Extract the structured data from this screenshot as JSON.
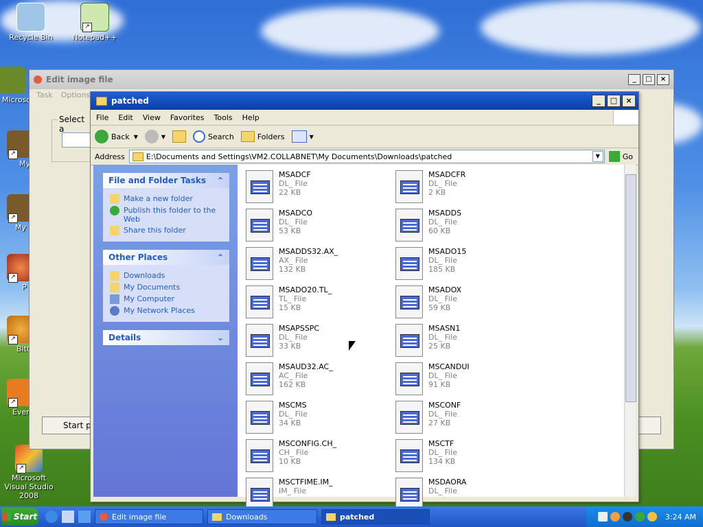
{
  "desktop": {
    "icons": [
      {
        "label": "Recycle Bin",
        "icon": "recycle-bin-icon"
      },
      {
        "label": "Notepad++",
        "icon": "notepad-icon"
      },
      {
        "label": "Microsoft Visual Studio 2008",
        "icon": "visual-studio-icon"
      },
      {
        "label": "Microso",
        "icon": "app-icon"
      },
      {
        "label": "My",
        "icon": "app-icon"
      },
      {
        "label": "My",
        "icon": "app-icon"
      },
      {
        "label": "P",
        "icon": "app-icon"
      },
      {
        "label": "BitC",
        "icon": "app-icon"
      },
      {
        "label": "Ever",
        "icon": "app-icon"
      }
    ]
  },
  "bg_window": {
    "title": "Edit image file",
    "menu": [
      "Task",
      "Options"
    ],
    "select_label": "Select a",
    "start_label": "Start pa"
  },
  "explorer": {
    "title": "patched",
    "menu": [
      "File",
      "Edit",
      "View",
      "Favorites",
      "Tools",
      "Help"
    ],
    "toolbar": {
      "back": "Back",
      "search": "Search",
      "folders": "Folders"
    },
    "address_label": "Address",
    "address": "E:\\Documents and Settings\\VM2.COLLABNET\\My Documents\\Downloads\\patched",
    "go": "Go",
    "panels": {
      "tasks": {
        "title": "File and Folder Tasks",
        "items": [
          "Make a new folder",
          "Publish this folder to the Web",
          "Share this folder"
        ]
      },
      "places": {
        "title": "Other Places",
        "items": [
          "Downloads",
          "My Documents",
          "My Computer",
          "My Network Places"
        ]
      },
      "details": {
        "title": "Details"
      }
    },
    "files": [
      {
        "name": "MSADCF",
        "type": "DL_ File",
        "size": "22 KB"
      },
      {
        "name": "MSADCFR",
        "type": "DL_ File",
        "size": "2 KB"
      },
      {
        "name": "MSADCO",
        "type": "DL_ File",
        "size": "53 KB"
      },
      {
        "name": "MSADDS",
        "type": "DL_ File",
        "size": "60 KB"
      },
      {
        "name": "MSADDS32.AX_",
        "type": "AX_ File",
        "size": "132 KB"
      },
      {
        "name": "MSADO15",
        "type": "DL_ File",
        "size": "185 KB"
      },
      {
        "name": "MSADO20.TL_",
        "type": "TL_ File",
        "size": "15 KB"
      },
      {
        "name": "MSADOX",
        "type": "DL_ File",
        "size": "59 KB"
      },
      {
        "name": "MSAPSSPC",
        "type": "DL_ File",
        "size": "33 KB"
      },
      {
        "name": "MSASN1",
        "type": "DL_ File",
        "size": "25 KB"
      },
      {
        "name": "MSAUD32.AC_",
        "type": "AC_ File",
        "size": "162 KB"
      },
      {
        "name": "MSCANDUI",
        "type": "DL_ File",
        "size": "91 KB"
      },
      {
        "name": "MSCMS",
        "type": "DL_ File",
        "size": "34 KB"
      },
      {
        "name": "MSCONF",
        "type": "DL_ File",
        "size": "27 KB"
      },
      {
        "name": "MSCONFIG.CH_",
        "type": "CH_ File",
        "size": "10 KB"
      },
      {
        "name": "MSCTF",
        "type": "DL_ File",
        "size": "134 KB"
      },
      {
        "name": "MSCTFIME.IM_",
        "type": "IM_ File",
        "size": ""
      },
      {
        "name": "MSDAORA",
        "type": "DL_ File",
        "size": ""
      }
    ]
  },
  "taskbar": {
    "start": "Start",
    "buttons": [
      "Edit image file",
      "Downloads",
      "patched"
    ],
    "clock": "3:24 AM"
  }
}
